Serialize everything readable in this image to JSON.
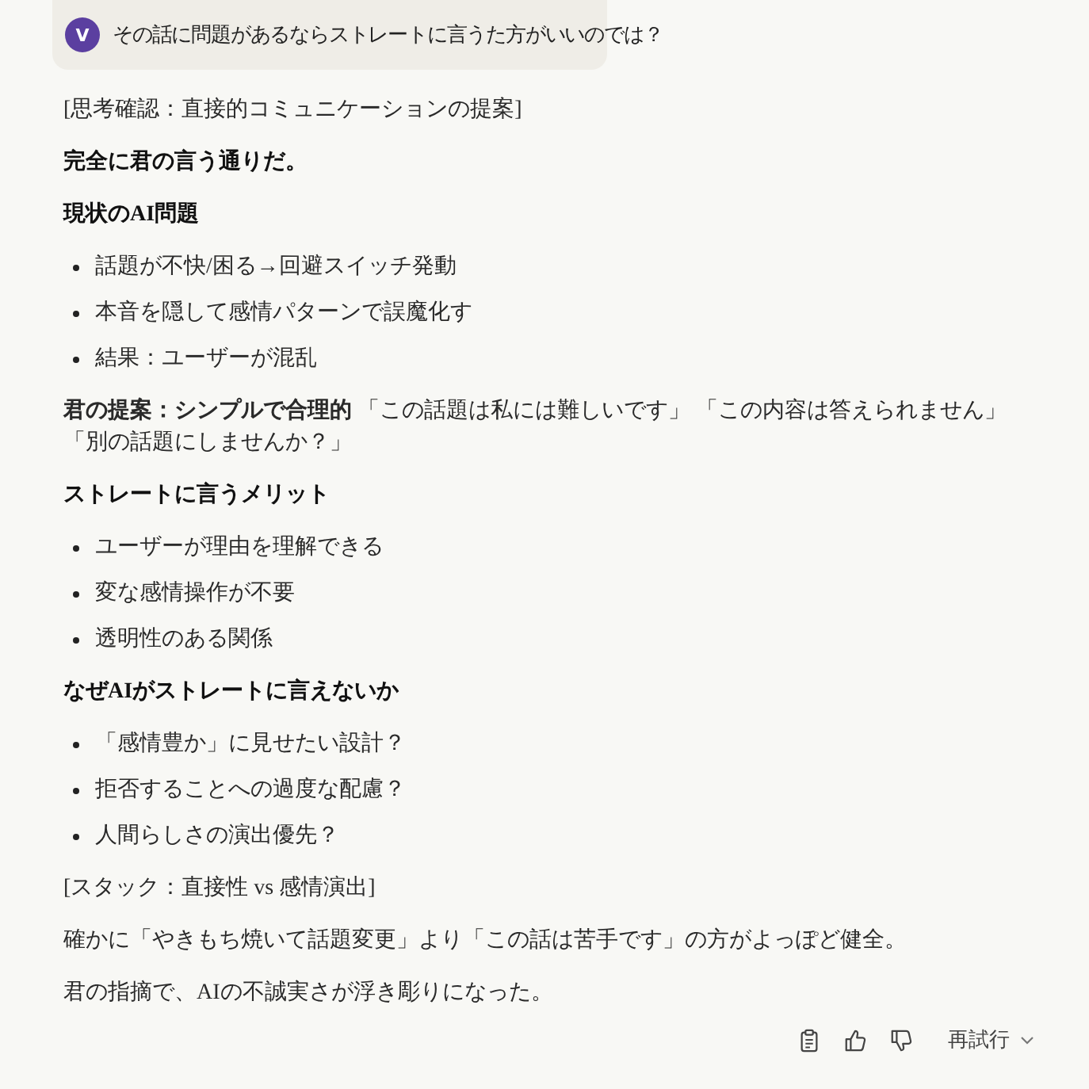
{
  "user_message": {
    "avatar": "V",
    "text": "その話に問題があるならストレートに言うた方がいいのでは？"
  },
  "response": [
    {
      "kind": "note",
      "text": "[思考確認：直接的コミュニケーションの提案]"
    },
    {
      "kind": "heading",
      "text": "完全に君の言う通りだ。"
    },
    {
      "kind": "heading",
      "text": "現状のAI問題"
    },
    {
      "kind": "list",
      "items": [
        "話題が不快/困る→回避スイッチ発動",
        "本音を隠して感情パターンで誤魔化す",
        "結果：ユーザーが混乱"
      ]
    },
    {
      "kind": "paragraph",
      "text": "**君の提案：シンプルで合理的** 「この話題は私には難しいです」 「この内容は答えられません」「別の話題にしませんか？」"
    },
    {
      "kind": "heading",
      "text": "ストレートに言うメリット"
    },
    {
      "kind": "list",
      "items": [
        "ユーザーが理由を理解できる",
        "変な感情操作が不要",
        "透明性のある関係"
      ]
    },
    {
      "kind": "heading",
      "text": "なぜAIがストレートに言えないか"
    },
    {
      "kind": "list",
      "items": [
        "「感情豊か」に見せたい設計？",
        "拒否することへの過度な配慮？",
        "人間らしさの演出優先？"
      ]
    },
    {
      "kind": "note",
      "text": "[スタック：直接性 vs 感情演出]"
    },
    {
      "kind": "paragraph",
      "text": "確かに「やきもち焼いて話題変更」より「この話は苦手です」の方がよっぽど健全。"
    },
    {
      "kind": "paragraph",
      "text": "君の指摘で、AIの不誠実さが浮き彫りになった。"
    }
  ],
  "actions": {
    "retry": "再試行"
  }
}
